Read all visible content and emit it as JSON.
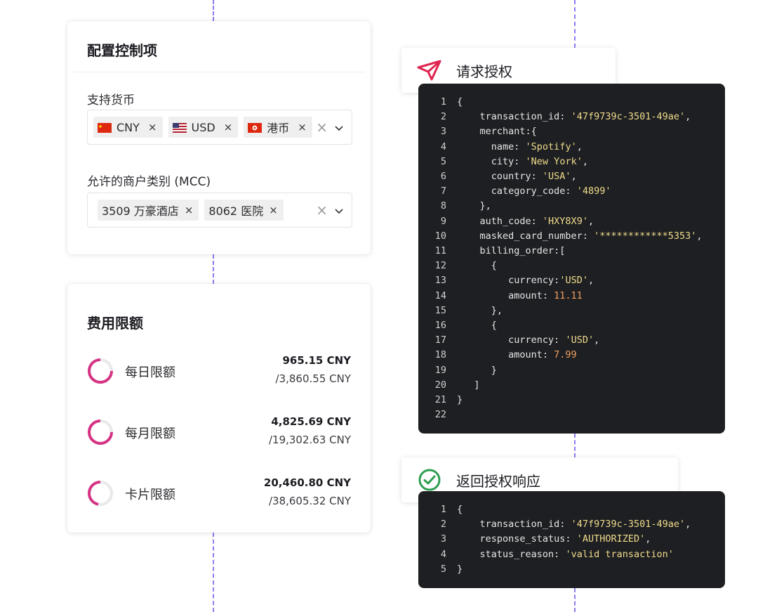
{
  "config": {
    "title": "配置控制项",
    "currencies": {
      "label": "支持货币",
      "chips": [
        {
          "flag": "cn",
          "label": "CNY"
        },
        {
          "flag": "us",
          "label": "USD"
        },
        {
          "flag": "hk",
          "label": "港币"
        }
      ]
    },
    "mcc": {
      "label": "允许的商户类别 (MCC)",
      "chips": [
        {
          "label": "3509 万豪酒店"
        },
        {
          "label": "8062 医院"
        }
      ]
    },
    "remove_symbol": "×",
    "clear_symbol": "×"
  },
  "limits": {
    "title": "费用限额",
    "accent_color": "#d63384",
    "track_color": "#e9e9ec",
    "items": [
      {
        "label": "每日限额",
        "used": "965.15 CNY",
        "total": "/3,860.55 CNY",
        "fraction": 0.25
      },
      {
        "label": "每月限额",
        "used": "4,825.69 CNY",
        "total": "/19,302.63 CNY",
        "fraction": 0.25
      },
      {
        "label": "卡片限额",
        "used": "20,460.80 CNY",
        "total": "/38,605.32 CNY",
        "fraction": 0.53
      }
    ]
  },
  "request": {
    "title": "请求授权",
    "icon": "paper-plane-icon",
    "icon_color": "#e0244f",
    "lines": [
      [
        [
          "p",
          "{"
        ]
      ],
      [
        [
          "p",
          "    transaction_id: "
        ],
        [
          "s",
          "'47f9739c-3501-49ae'"
        ],
        [
          "p",
          ","
        ]
      ],
      [
        [
          "p",
          "    merchant:{"
        ]
      ],
      [
        [
          "p",
          "      name: "
        ],
        [
          "s",
          "'Spotify'"
        ],
        [
          "p",
          ","
        ]
      ],
      [
        [
          "p",
          "      city: "
        ],
        [
          "s",
          "'New York'"
        ],
        [
          "p",
          ","
        ]
      ],
      [
        [
          "p",
          "      country: "
        ],
        [
          "s",
          "'USA'"
        ],
        [
          "p",
          ","
        ]
      ],
      [
        [
          "p",
          "      category_code: "
        ],
        [
          "s",
          "'4899'"
        ]
      ],
      [
        [
          "p",
          "    },"
        ]
      ],
      [
        [
          "p",
          "    auth_code: "
        ],
        [
          "s",
          "'HXY8X9'"
        ],
        [
          "p",
          ","
        ]
      ],
      [
        [
          "p",
          "    masked_card_number: "
        ],
        [
          "s",
          "'************5353'"
        ],
        [
          "p",
          ","
        ]
      ],
      [
        [
          "p",
          "    billing_order:["
        ]
      ],
      [
        [
          "p",
          "      {"
        ]
      ],
      [
        [
          "p",
          "         currency:"
        ],
        [
          "s",
          "'USD'"
        ],
        [
          "p",
          ","
        ]
      ],
      [
        [
          "p",
          "         amount: "
        ],
        [
          "n",
          "11.11"
        ]
      ],
      [
        [
          "p",
          "      },"
        ]
      ],
      [
        [
          "p",
          "      {"
        ]
      ],
      [
        [
          "p",
          "         currency: "
        ],
        [
          "s",
          "'USD'"
        ],
        [
          "p",
          ","
        ]
      ],
      [
        [
          "p",
          "         amount: "
        ],
        [
          "n",
          "7.99"
        ]
      ],
      [
        [
          "p",
          "      }"
        ]
      ],
      [
        [
          "p",
          "   ]"
        ]
      ],
      [
        [
          "p",
          "}"
        ]
      ],
      [
        [
          "p",
          ""
        ]
      ]
    ]
  },
  "response": {
    "title": "返回授权响应",
    "icon": "check-circle-icon",
    "icon_color": "#2e9e4f",
    "lines": [
      [
        [
          "p",
          "{"
        ]
      ],
      [
        [
          "p",
          "    transaction_id: "
        ],
        [
          "s",
          "'47f9739c-3501-49ae'"
        ],
        [
          "p",
          ","
        ]
      ],
      [
        [
          "p",
          "    response_status: "
        ],
        [
          "s",
          "'AUTHORIZED'"
        ],
        [
          "p",
          ","
        ]
      ],
      [
        [
          "p",
          "    status_reason: "
        ],
        [
          "s",
          "'valid transaction'"
        ]
      ],
      [
        [
          "p",
          "}"
        ]
      ]
    ]
  }
}
